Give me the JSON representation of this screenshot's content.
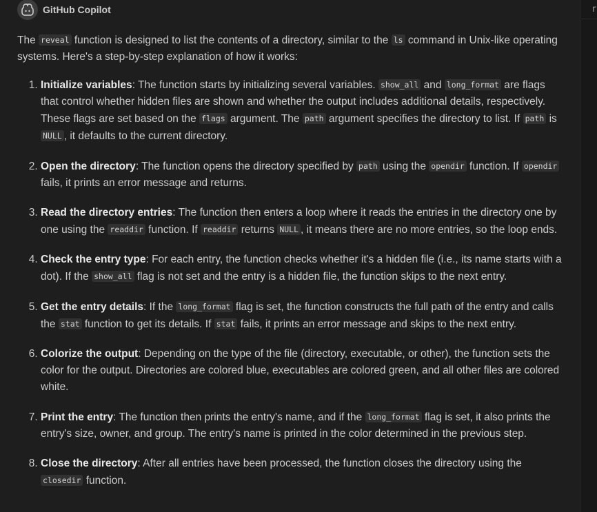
{
  "header": {
    "author": "GitHub Copilot",
    "avatar_icon": "copilot-icon"
  },
  "right_panel": {
    "tab_fragment": "r"
  },
  "intro": [
    {
      "t": "The "
    },
    {
      "c": "reveal"
    },
    {
      "t": " function is designed to list the contents of a directory, similar to the "
    },
    {
      "c": "ls"
    },
    {
      "t": " command in Unix-like operating systems. Here's a step-by-step explanation of how it works:"
    }
  ],
  "steps": [
    {
      "title": "Initialize variables",
      "parts": [
        {
          "t": ": The function starts by initializing several variables. "
        },
        {
          "c": "show_all"
        },
        {
          "t": " and "
        },
        {
          "c": "long_format"
        },
        {
          "t": " are flags that control whether hidden files are shown and whether the output includes additional details, respectively. These flags are set based on the "
        },
        {
          "c": "flags"
        },
        {
          "t": " argument. The "
        },
        {
          "c": "path"
        },
        {
          "t": " argument specifies the directory to list. If "
        },
        {
          "c": "path"
        },
        {
          "t": " is "
        },
        {
          "c": "NULL"
        },
        {
          "t": ", it defaults to the current directory."
        }
      ]
    },
    {
      "title": "Open the directory",
      "parts": [
        {
          "t": ": The function opens the directory specified by "
        },
        {
          "c": "path"
        },
        {
          "t": " using the "
        },
        {
          "c": "opendir"
        },
        {
          "t": " function. If "
        },
        {
          "c": "opendir"
        },
        {
          "t": " fails, it prints an error message and returns."
        }
      ]
    },
    {
      "title": "Read the directory entries",
      "parts": [
        {
          "t": ": The function then enters a loop where it reads the entries in the directory one by one using the "
        },
        {
          "c": "readdir"
        },
        {
          "t": " function. If "
        },
        {
          "c": "readdir"
        },
        {
          "t": " returns "
        },
        {
          "c": "NULL"
        },
        {
          "t": ", it means there are no more entries, so the loop ends."
        }
      ]
    },
    {
      "title": "Check the entry type",
      "parts": [
        {
          "t": ": For each entry, the function checks whether it's a hidden file (i.e., its name starts with a dot). If the "
        },
        {
          "c": "show_all"
        },
        {
          "t": " flag is not set and the entry is a hidden file, the function skips to the next entry."
        }
      ]
    },
    {
      "title": "Get the entry details",
      "parts": [
        {
          "t": ": If the "
        },
        {
          "c": "long_format"
        },
        {
          "t": " flag is set, the function constructs the full path of the entry and calls the "
        },
        {
          "c": "stat"
        },
        {
          "t": " function to get its details. If "
        },
        {
          "c": "stat"
        },
        {
          "t": " fails, it prints an error message and skips to the next entry."
        }
      ]
    },
    {
      "title": "Colorize the output",
      "parts": [
        {
          "t": ": Depending on the type of the file (directory, executable, or other), the function sets the color for the output. Directories are colored blue, executables are colored green, and all other files are colored white."
        }
      ]
    },
    {
      "title": "Print the entry",
      "parts": [
        {
          "t": ": The function then prints the entry's name, and if the "
        },
        {
          "c": "long_format"
        },
        {
          "t": " flag is set, it also prints the entry's size, owner, and group. The entry's name is printed in the color determined in the previous step."
        }
      ]
    },
    {
      "title": "Close the directory",
      "parts": [
        {
          "t": ": After all entries have been processed, the function closes the directory using the "
        },
        {
          "c": "closedir"
        },
        {
          "t": " function."
        }
      ]
    }
  ]
}
